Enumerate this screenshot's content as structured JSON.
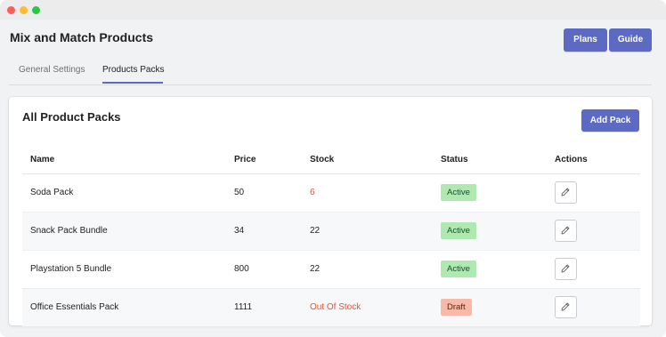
{
  "app": {
    "title": "Mix and Match Products",
    "accent_color": "#5c6ac4"
  },
  "header_buttons": {
    "plans_label": "Plans",
    "guide_label": "Guide"
  },
  "tabs": [
    {
      "label": "General Settings",
      "selected": false
    },
    {
      "label": "Products Packs",
      "selected": true
    }
  ],
  "card": {
    "title": "All Product Packs",
    "add_button_label": "Add Pack"
  },
  "table": {
    "columns": [
      "Name",
      "Price",
      "Stock",
      "Status",
      "Actions"
    ],
    "rows": [
      {
        "name": "Soda Pack",
        "price": "50",
        "stock": "6",
        "status": "Active"
      },
      {
        "name": "Snack Pack Bundle",
        "price": "34",
        "stock": "22",
        "status": "Active"
      },
      {
        "name": "Playstation 5 Bundle",
        "price": "800",
        "stock": "22",
        "status": "Active"
      },
      {
        "name": "Office Essentials Pack",
        "price": "1111",
        "stock": "Out Of Stock",
        "status": "Draft"
      }
    ],
    "action_icon": "pencil-edit-icon"
  }
}
